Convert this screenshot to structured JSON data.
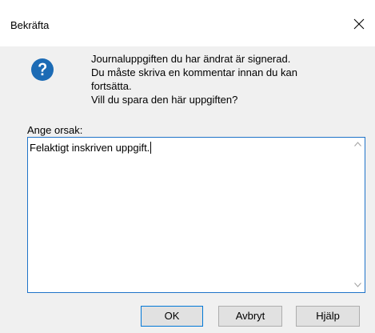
{
  "window": {
    "title": "Bekräfta",
    "close_icon": "close-icon"
  },
  "message": {
    "icon": "question-icon",
    "lines": [
      "Journaluppgiften du har ändrat är signerad.",
      "Du måste skriva en kommentar innan du kan",
      "fortsätta.",
      "Vill du spara den här uppgiften?"
    ]
  },
  "reason": {
    "label": "Ange orsak:",
    "value": "Felaktigt inskriven uppgift."
  },
  "buttons": {
    "ok": "OK",
    "cancel": "Avbryt",
    "help": "Hjälp"
  },
  "colors": {
    "icon_blue": "#1c6bb5",
    "focus_border": "#1f73c8",
    "dialog_bg": "#f0f0f0",
    "title_bg": "#ffffff"
  }
}
